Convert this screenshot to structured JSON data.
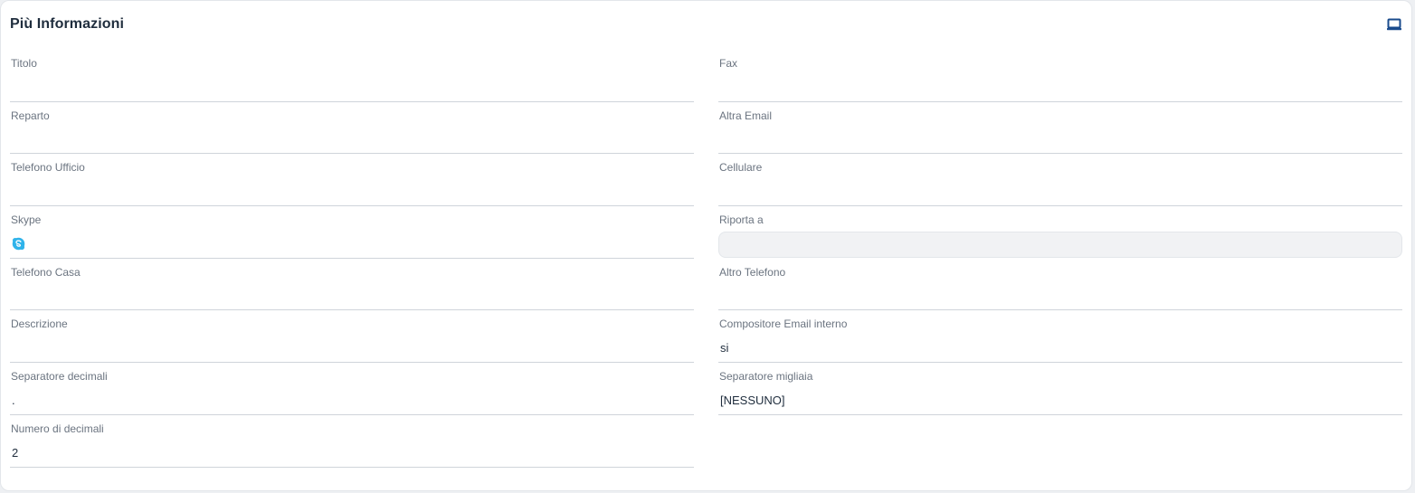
{
  "panel": {
    "title": "Più Informazioni",
    "header_icon": "laptop-icon",
    "accent_color": "#1a4b8c"
  },
  "fields": {
    "titolo": {
      "label": "Titolo",
      "value": ""
    },
    "fax": {
      "label": "Fax",
      "value": ""
    },
    "reparto": {
      "label": "Reparto",
      "value": ""
    },
    "altra_email": {
      "label": "Altra Email",
      "value": ""
    },
    "telefono_ufficio": {
      "label": "Telefono Ufficio",
      "value": ""
    },
    "cellulare": {
      "label": "Cellulare",
      "value": ""
    },
    "skype": {
      "label": "Skype",
      "value": "",
      "icon": "skype-icon"
    },
    "riporta_a": {
      "label": "Riporta a",
      "value": ""
    },
    "telefono_casa": {
      "label": "Telefono Casa",
      "value": ""
    },
    "altro_telefono": {
      "label": "Altro Telefono",
      "value": ""
    },
    "descrizione": {
      "label": "Descrizione",
      "value": ""
    },
    "compositore_email": {
      "label": "Compositore Email interno",
      "value": "si"
    },
    "separatore_decimali": {
      "label": "Separatore decimali",
      "value": "."
    },
    "separatore_migliaia": {
      "label": "Separatore migliaia",
      "value": "[NESSUNO]"
    },
    "numero_decimali": {
      "label": "Numero di decimali",
      "value": "2"
    }
  }
}
